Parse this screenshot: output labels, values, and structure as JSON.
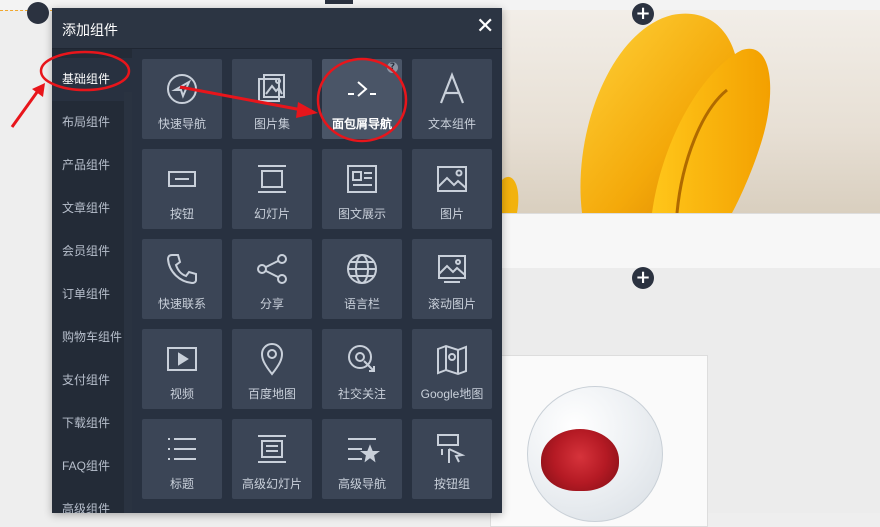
{
  "panel": {
    "title": "添加组件",
    "close": "✕"
  },
  "sidebar": {
    "items": [
      {
        "label": "基础组件",
        "active": true
      },
      {
        "label": "布局组件"
      },
      {
        "label": "产品组件"
      },
      {
        "label": "文章组件"
      },
      {
        "label": "会员组件"
      },
      {
        "label": "订单组件"
      },
      {
        "label": "购物车组件"
      },
      {
        "label": "支付组件"
      },
      {
        "label": "下载组件"
      },
      {
        "label": "FAQ组件"
      },
      {
        "label": "高级组件"
      }
    ]
  },
  "components": [
    {
      "label": "快速导航",
      "icon": "compass-icon"
    },
    {
      "label": "图片集",
      "icon": "image-gallery-icon"
    },
    {
      "label": "面包屑导航",
      "icon": "breadcrumb-icon",
      "selected": true,
      "badge": "?"
    },
    {
      "label": "文本组件",
      "icon": "letter-a-icon"
    },
    {
      "label": "按钮",
      "icon": "button-icon"
    },
    {
      "label": "幻灯片",
      "icon": "slideshow-icon"
    },
    {
      "label": "图文展示",
      "icon": "image-text-icon"
    },
    {
      "label": "图片",
      "icon": "image-icon"
    },
    {
      "label": "快速联系",
      "icon": "phone-icon"
    },
    {
      "label": "分享",
      "icon": "share-icon"
    },
    {
      "label": "语言栏",
      "icon": "globe-icon"
    },
    {
      "label": "滚动图片",
      "icon": "scroll-image-icon"
    },
    {
      "label": "视频",
      "icon": "video-icon"
    },
    {
      "label": "百度地图",
      "icon": "map-pin-icon"
    },
    {
      "label": "社交关注",
      "icon": "social-follow-icon"
    },
    {
      "label": "Google地图",
      "icon": "google-map-icon"
    },
    {
      "label": "标题",
      "icon": "list-title-icon"
    },
    {
      "label": "高级幻灯片",
      "icon": "advanced-slideshow-icon"
    },
    {
      "label": "高级导航",
      "icon": "advanced-nav-icon"
    },
    {
      "label": "按钮组",
      "icon": "button-group-icon"
    }
  ],
  "canvas": {
    "add_symbol": "+"
  },
  "colors": {
    "panel_bg": "#283140",
    "tile_bg": "#3b4556",
    "annotation_red": "#e8151b",
    "guide_line": "#f0a830"
  }
}
